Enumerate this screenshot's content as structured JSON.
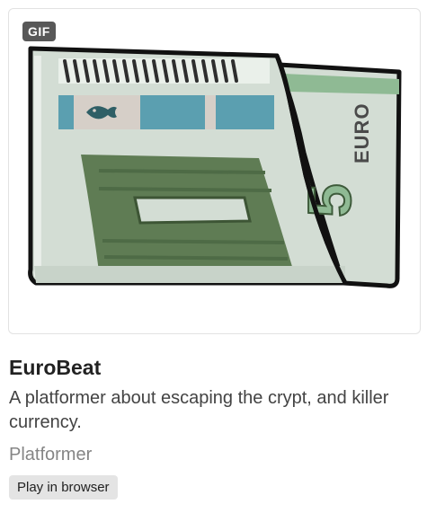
{
  "game_cell": {
    "badge": "GIF",
    "title": "EuroBeat",
    "description": "A platformer about escaping the crypt, and killer currency.",
    "genre": "Platformer",
    "play_button": "Play in browser"
  },
  "thumbnail": {
    "note_text": "EURO",
    "note_value": "5",
    "colors": {
      "paper": "#d3ddd4",
      "band_teal": "#5b9fb0",
      "band_green": "#8fba94",
      "dark_green": "#5f7c54",
      "outline": "#111111"
    }
  }
}
